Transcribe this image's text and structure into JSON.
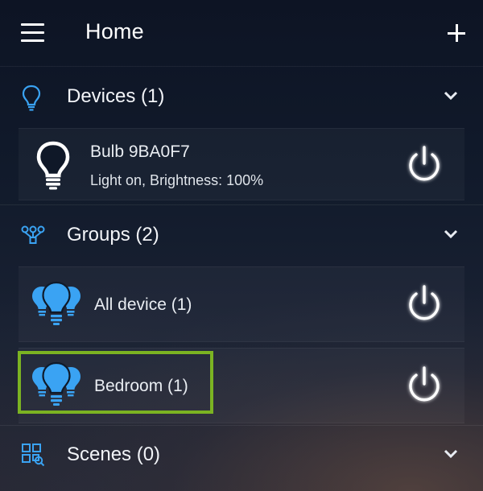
{
  "header": {
    "title": "Home"
  },
  "sections": {
    "devices": {
      "label": "Devices (1)",
      "items": [
        {
          "name": "Bulb 9BA0F7",
          "status": "Light on, Brightness: 100%"
        }
      ]
    },
    "groups": {
      "label": "Groups (2)",
      "items": [
        {
          "name": "All device (1)"
        },
        {
          "name": "Bedroom (1)"
        }
      ]
    },
    "scenes": {
      "label": "Scenes (0)"
    }
  },
  "icons": {
    "menu": "hamburger-menu-icon",
    "add": "plus-icon",
    "devices": "lightbulb-outline-icon",
    "groups": "network-tree-icon",
    "scenes": "scenes-grid-icon",
    "expand": "chevron-down-icon",
    "power": "power-icon",
    "bulb_white": "lightbulb-white-icon",
    "bulb_group": "multi-lightbulb-icon"
  },
  "colors": {
    "accent_blue": "#3aa3f3",
    "highlight_green": "#7bb322"
  }
}
